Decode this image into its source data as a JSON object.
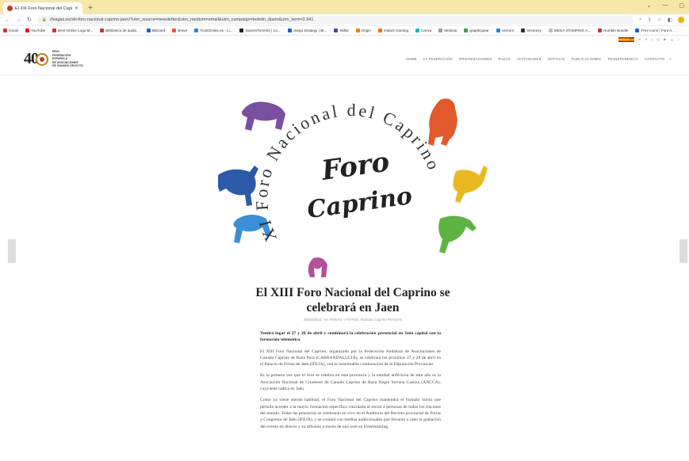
{
  "browser": {
    "tab_title": "El XIII Foro Nacional del Caprino",
    "tab_close": "✕",
    "new_tab": "+",
    "window_controls": [
      "⌄",
      "—",
      "▢"
    ],
    "url": "rfeagas.es/xiii-foro-nacional-caprino-jaen/?utm_source=newsletter&utm_medium=email&utm_campaign=boletin_diario&utm_term=2.941",
    "bookmarks": [
      {
        "label": "Gmail",
        "color": "#d93025"
      },
      {
        "label": "YouTube",
        "color": "#ff0000"
      },
      {
        "label": "Best Online Logo M...",
        "color": "#c0392b"
      },
      {
        "label": "Biblioteca de audio...",
        "color": "#c0392b"
      },
      {
        "label": "Blizzard",
        "color": "#1565c0"
      },
      {
        "label": "Brave",
        "color": "#fb542b"
      },
      {
        "label": "TrustOnline.es - Li...",
        "color": "#1e88e5"
      },
      {
        "label": "GamesTorrents | La...",
        "color": "#222222"
      },
      {
        "label": "Juego Strategy | Br...",
        "color": "#1565c0"
      },
      {
        "label": "skillid",
        "color": "#3949ab"
      },
      {
        "label": "Origin",
        "color": "#f57c00"
      },
      {
        "label": "Instant Gaming",
        "color": "#ff6f00"
      },
      {
        "label": "Canva",
        "color": "#00bcd4"
      },
      {
        "label": "Molonia",
        "color": "#9e9e9e"
      },
      {
        "label": "graphicpear",
        "color": "#43a047"
      },
      {
        "label": "Vectorn",
        "color": "#1e88e5"
      },
      {
        "label": "Vecteezy",
        "color": "#333333"
      },
      {
        "label": "MEGA STAMPING A...",
        "color": "#bdbdbd"
      },
      {
        "label": "Humble Bundle",
        "color": "#cc3333"
      },
      {
        "label": "Free Icons | Font A...",
        "color": "#1565c0"
      }
    ]
  },
  "site": {
    "logo_number": "40",
    "logo_text": [
      "REAL",
      "FEDERACIÓN",
      "ESPAÑOLA",
      "DE ASOCIACIONES",
      "DE GANADO SELECTO"
    ],
    "lang_flag": "ES",
    "nav": [
      "HOME",
      "LA FEDERACIÓN",
      "ORGANIZACIONES",
      "RAZAS",
      "ACTIVIDADES",
      "NOTICIAS",
      "PUBLICACIONES",
      "TRANSPARENCIA",
      "CONTACTO"
    ]
  },
  "hero": {
    "arc_text": "XI Foro Nacional del Caprino",
    "logo_line1": "Foro",
    "logo_line2": "Caprino",
    "colors": [
      "#7b4fa0",
      "#e05a2b",
      "#e8b923",
      "#5fb343",
      "#3b8fd6",
      "#2a5aa8",
      "#b44f9a"
    ]
  },
  "article": {
    "title": "El XIII Foro Nacional del Caprino se celebrará en Jaen",
    "meta": "29/03/2023 / en FERIAS Y FOTOS, Noticias Caprino FEAGAS",
    "lead": "Tendrá lugar el 27 y 28 de abril y combinará la celebración presencial en Jaén capital con la formación telemática",
    "p1": "El XIII Foro Nacional del Caprino, organizado por la Federación Andaluza de Asociaciones de Ganado Caprino de Raza Pura (CABRANDALUCÍA), se celebrará los próximos 27 y 28 de abril en el Palacio de Ferias de Jaén (IFEJA), con la inestimable colaboración de la Diputación Provincial.",
    "p2": "Es la primera vez que el foro se celebra en esta provincia y la entidad anfitriona de este año es la Asociación Nacional de Criadores de Ganado Caprino de Raza Negra Serrana Castiza (ANCCA), cuya sede radica en Jaén.",
    "p3": "Como ya viene siendo habitual, el Foro Nacional del Caprino mantendrá el formato mixto que permite acceder a la mayor formación específica vinculada al sector a personas de todos los rincones del mundo. Todas las ponencias se celebrarán en vivo en el Auditorio del Recinto provincial de Ferias y Congresos de Jaén (IFEJA), y se contará con medios audiovisuales que llevarán a cabo la grabación del evento en directo y su difusión a través de una web en livestreaming."
  }
}
